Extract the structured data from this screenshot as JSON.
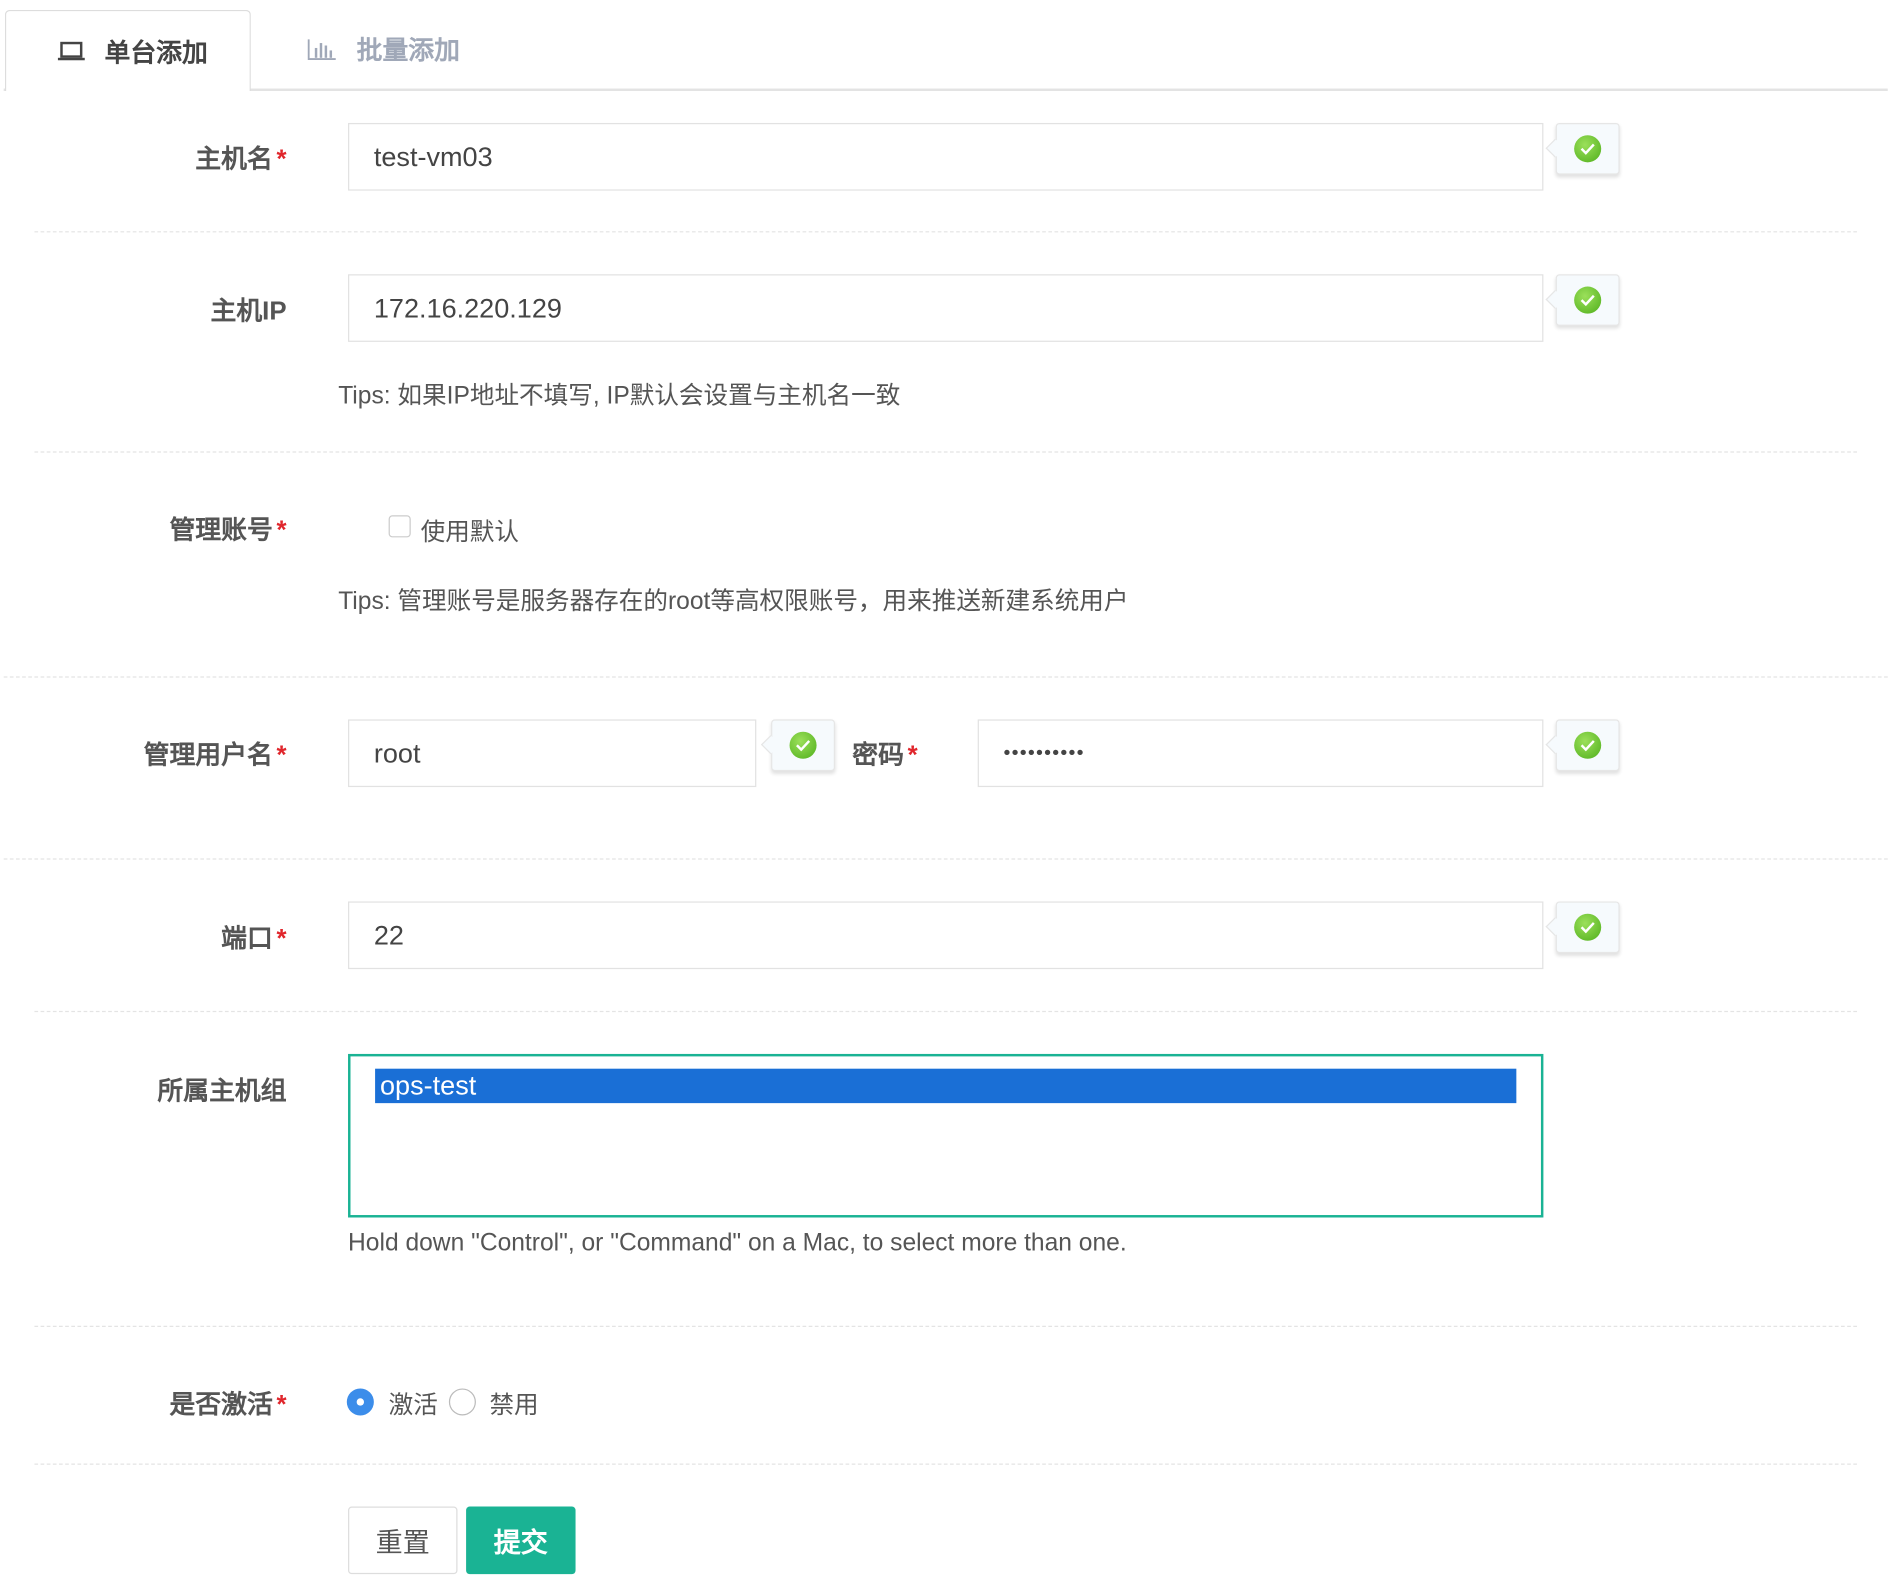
{
  "tabs": [
    {
      "label": "单台添加",
      "icon": "laptop-icon",
      "active": true
    },
    {
      "label": "批量添加",
      "icon": "bar-chart-icon",
      "active": false
    }
  ],
  "form": {
    "hostname": {
      "label": "主机名",
      "required": "*",
      "value": "test-vm03"
    },
    "host_ip": {
      "label": "主机IP",
      "value": "172.16.220.129",
      "tips": "Tips: 如果IP地址不填写, IP默认会设置与主机名一致"
    },
    "admin_account": {
      "label": "管理账号",
      "required": "*",
      "checkbox_label": "使用默认",
      "checked": false,
      "tips": "Tips: 管理账号是服务器存在的root等高权限账号，用来推送新建系统用户"
    },
    "admin_user": {
      "label": "管理用户名",
      "required": "*",
      "value": "root"
    },
    "password": {
      "label": "密码",
      "required": "*",
      "value": "••••••••••"
    },
    "port": {
      "label": "端口",
      "required": "*",
      "value": "22"
    },
    "host_group": {
      "label": "所属主机组",
      "options": [
        "ops-test"
      ],
      "selected": "ops-test",
      "help": "Hold down \"Control\", or \"Command\" on a Mac, to select more than one."
    },
    "active": {
      "label": "是否激活",
      "required": "*",
      "options": [
        "激活",
        "禁用"
      ],
      "selected": "激活"
    }
  },
  "buttons": {
    "reset": "重置",
    "submit": "提交"
  },
  "colors": {
    "accent": "#1ab394",
    "select_highlight": "#1a6fd6",
    "required": "#e0262c",
    "radio": "#3c8dea"
  }
}
